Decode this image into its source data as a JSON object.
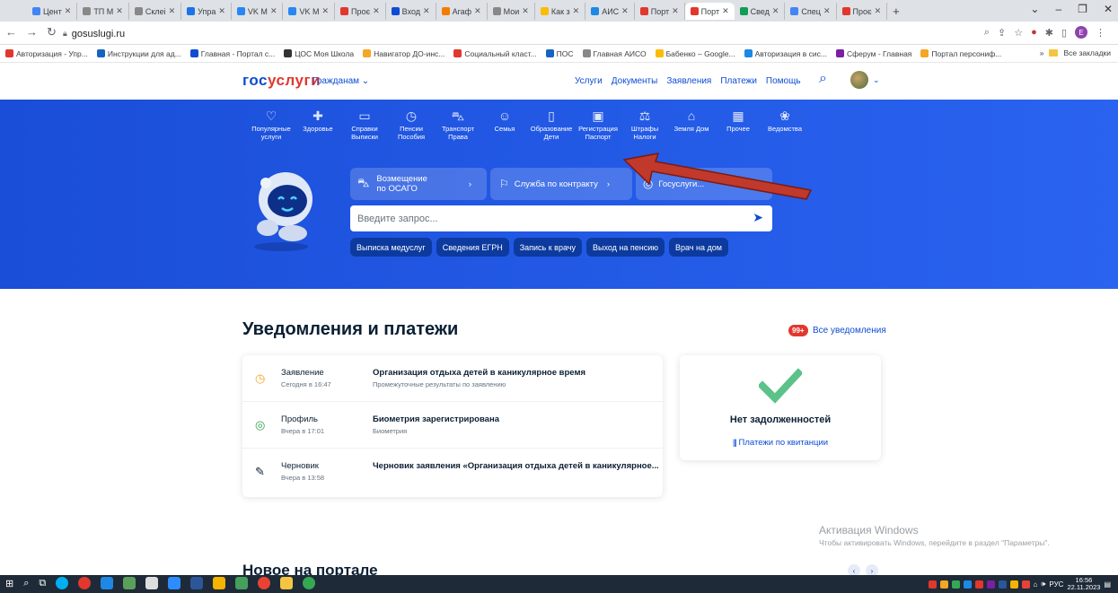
{
  "browser": {
    "tabs": [
      {
        "label": "Цент",
        "color": "#4285f4"
      },
      {
        "label": "ТП М",
        "color": "#888"
      },
      {
        "label": "Склеі",
        "color": "#888"
      },
      {
        "label": "Упра",
        "color": "#1a73e8"
      },
      {
        "label": "VK М",
        "color": "#2787f5"
      },
      {
        "label": "VK М",
        "color": "#2787f5"
      },
      {
        "label": "Проє",
        "color": "#e1372d"
      },
      {
        "label": "Вход",
        "color": "#0d4cd3"
      },
      {
        "label": "Агаф",
        "color": "#f57c00"
      },
      {
        "label": "Мои",
        "color": "#888"
      },
      {
        "label": "Как з",
        "color": "#fbbc05"
      },
      {
        "label": "АИС",
        "color": "#1e88e5"
      },
      {
        "label": "Порт",
        "color": "#e1372d"
      },
      {
        "label": "Порт",
        "color": "#e1372d",
        "active": true
      },
      {
        "label": "Свед",
        "color": "#0f9d58"
      },
      {
        "label": "Спец",
        "color": "#4285f4"
      },
      {
        "label": "Проє",
        "color": "#e1372d"
      }
    ],
    "url": "gosuslugi.ru",
    "bookmarks": [
      {
        "label": "Авторизация - Упр...",
        "color": "#e1372d"
      },
      {
        "label": "Инструкции для ад...",
        "color": "#1565c0"
      },
      {
        "label": "Главная - Портал с...",
        "color": "#0d4cd3"
      },
      {
        "label": "ЦОС Моя Школа",
        "color": "#333"
      },
      {
        "label": "Навигатор ДО-инс...",
        "color": "#f5a623"
      },
      {
        "label": "Социальный класт...",
        "color": "#e1372d"
      },
      {
        "label": "ПОС",
        "color": "#1565c0"
      },
      {
        "label": "Главная АИСО",
        "color": "#888"
      },
      {
        "label": "Бабенко – Google...",
        "color": "#fbbc05"
      },
      {
        "label": "Авторизация в сис...",
        "color": "#1e88e5"
      },
      {
        "label": "Сферум - Главная",
        "color": "#7b1fa2"
      },
      {
        "label": "Портал персониф...",
        "color": "#f5a623"
      }
    ],
    "bookmarks_more": "»",
    "all_bookmarks": "Все закладки"
  },
  "header": {
    "logo_part1": "гос",
    "logo_part2": "услуги",
    "role": "Гражданам ⌄",
    "nav": [
      "Услуги",
      "Документы",
      "Заявления",
      "Платежи",
      "Помощь"
    ]
  },
  "categories": [
    {
      "icon": "♡",
      "label": "Популярные\nуслуги"
    },
    {
      "icon": "✚",
      "label": "Здоровье"
    },
    {
      "icon": "▭",
      "label": "Справки\nВыписки"
    },
    {
      "icon": "◷",
      "label": "Пенсии\nПособия"
    },
    {
      "icon": "⛍",
      "label": "Транспорт\nПрава"
    },
    {
      "icon": "☺",
      "label": "Семья"
    },
    {
      "icon": "▯",
      "label": "Образование\nДети"
    },
    {
      "icon": "▣",
      "label": "Регистрация\nПаспорт"
    },
    {
      "icon": "⚖",
      "label": "Штрафы\nНалоги"
    },
    {
      "icon": "⌂",
      "label": "Земля Дом"
    },
    {
      "icon": "▦",
      "label": "Прочее"
    },
    {
      "icon": "❀",
      "label": "Ведомства"
    }
  ],
  "quick": {
    "q1_line1": "Возмещение",
    "q1_line2": "по ОСАГО",
    "q2": "Служба по контракту",
    "q3": "Госуслуги..."
  },
  "search_placeholder": "Введите запрос...",
  "chips": [
    "Выписка медуслуг",
    "Сведения ЕГРН",
    "Запись к врачу",
    "Выход на пенсию",
    "Врач на дом"
  ],
  "notifications": {
    "title": "Уведомления и платежи",
    "badge": "99+",
    "all_link": "Все уведомления",
    "items": [
      {
        "icon": "◷",
        "type": "Заявление",
        "date": "Сегодня в 16:47",
        "heading": "Организация отдыха детей в каникулярное время",
        "sub": "Промежуточные результаты по заявлению",
        "icon_color": "#f5a623"
      },
      {
        "icon": "◎",
        "type": "Профиль",
        "date": "Вчера в 17:01",
        "heading": "Биометрия зарегистрирована",
        "sub": "Биометрия",
        "icon_color": "#2e9e4f"
      },
      {
        "icon": "✎",
        "type": "Черновик",
        "date": "Вчера в 13:58",
        "heading": "Черновик заявления «Организация отдыха детей в каникулярное...",
        "sub": "",
        "icon_color": "#0b1f33"
      }
    ]
  },
  "debt": {
    "text": "Нет задолженностей",
    "link": "Платежи по квитанции"
  },
  "windows_activation": {
    "line1": "Активация Windows",
    "line2": "Чтобы активировать Windows, перейдите в раздел \"Параметры\"."
  },
  "new_on_portal": "Новое на портале",
  "pager": [
    "‹",
    "›"
  ],
  "taskbar": {
    "lang": "РУС",
    "time": "16:56",
    "date": "22.11.2023"
  }
}
